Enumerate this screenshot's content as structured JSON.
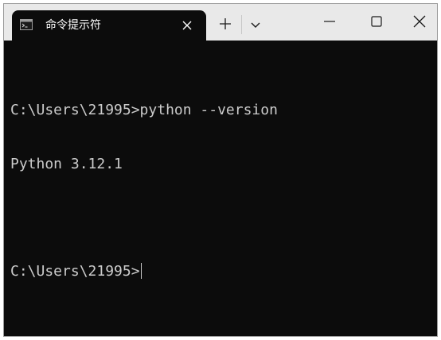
{
  "tab": {
    "title": "命令提示符",
    "icon": "command-prompt-icon"
  },
  "titlebar_buttons": {
    "new_tab": "plus-icon",
    "dropdown": "chevron-down-icon",
    "minimize": "minimize-icon",
    "maximize": "maximize-icon",
    "close": "close-icon"
  },
  "terminal": {
    "lines": [
      "C:\\Users\\21995>python --version",
      "Python 3.12.1",
      "",
      "C:\\Users\\21995>"
    ],
    "background": "#0c0c0c",
    "foreground": "#cccccc"
  }
}
